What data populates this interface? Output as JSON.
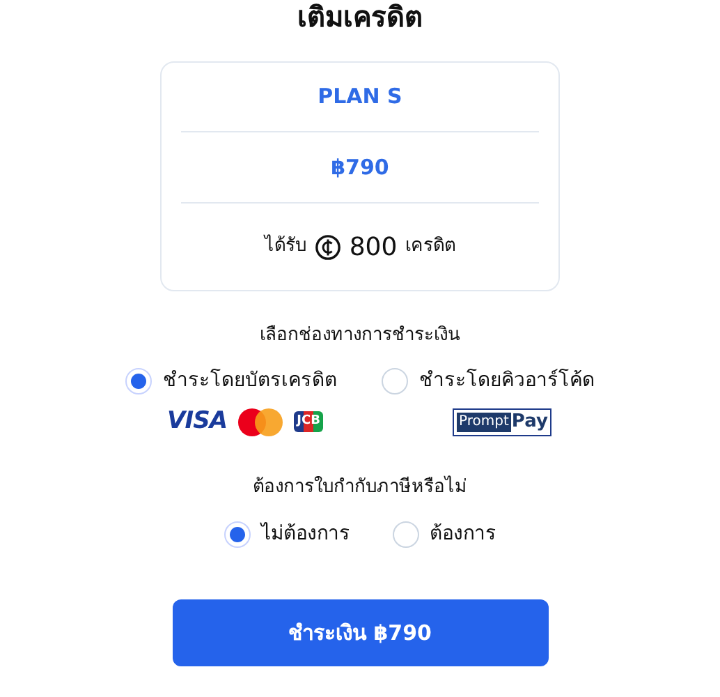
{
  "title": "เติมเครดิต",
  "plan": {
    "name": "PLAN S",
    "price": "฿790",
    "receive_label": "ได้รับ",
    "credits": "800",
    "credits_unit": "เครดิต"
  },
  "payment": {
    "label": "เลือกช่องทางการชำระเงิน",
    "options": [
      {
        "label": "ชำระโดยบัตรเครดิต",
        "selected": true,
        "logos": [
          {
            "kind": "visa",
            "text": "VISA"
          },
          {
            "kind": "mastercard"
          },
          {
            "kind": "jcb",
            "text": "JCB"
          }
        ]
      },
      {
        "label": "ชำระโดยคิวอาร์โค้ด",
        "selected": false,
        "logos": [
          {
            "kind": "promptpay",
            "text": "Prompt",
            "text2": "Pay"
          }
        ]
      }
    ]
  },
  "tax_invoice": {
    "label": "ต้องการใบกำกับภาษีหรือไม่",
    "options": [
      {
        "label": "ไม่ต้องการ",
        "selected": true
      },
      {
        "label": "ต้องการ",
        "selected": false
      }
    ]
  },
  "submit": {
    "label": "ชำระเงิน ฿790"
  }
}
